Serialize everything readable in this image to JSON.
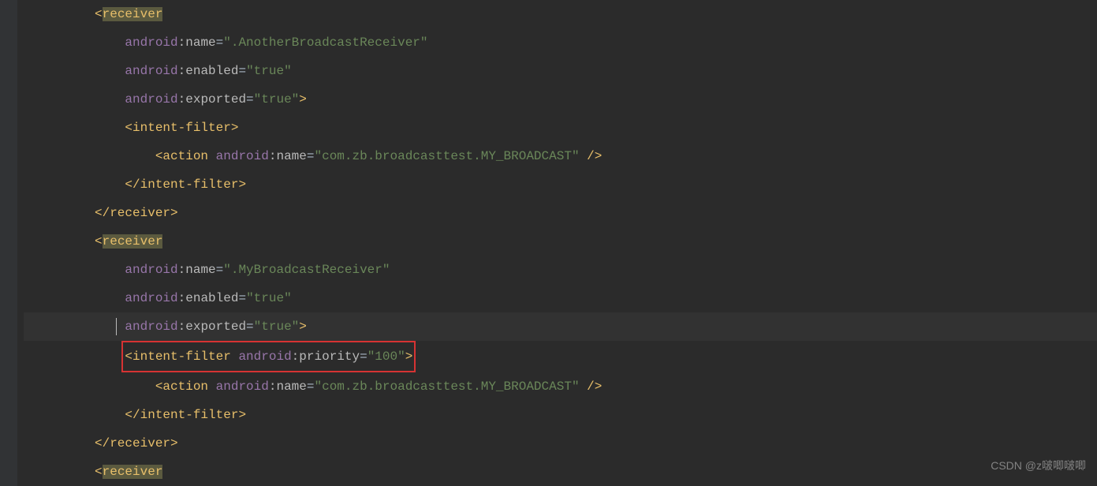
{
  "code": {
    "line1": {
      "tag": "receiver"
    },
    "line2": {
      "ns": "android",
      "attr": "name",
      "val": "\".AnotherBroadcastReceiver\""
    },
    "line3": {
      "ns": "android",
      "attr": "enabled",
      "val": "\"true\""
    },
    "line4": {
      "ns": "android",
      "attr": "exported",
      "val": "\"true\""
    },
    "line5": {
      "tag": "intent-filter"
    },
    "line6": {
      "tag": "action",
      "ns": "android",
      "attr": "name",
      "val": "\"com.zb.broadcasttest.MY_BROADCAST\""
    },
    "line7": {
      "tag": "intent-filter"
    },
    "line8": {
      "tag": "receiver"
    },
    "line9": {
      "tag": "receiver"
    },
    "line10": {
      "ns": "android",
      "attr": "name",
      "val": "\".MyBroadcastReceiver\""
    },
    "line11": {
      "ns": "android",
      "attr": "enabled",
      "val": "\"true\""
    },
    "line12": {
      "ns": "android",
      "attr": "exported",
      "val": "\"true\""
    },
    "line13": {
      "tag": "intent-filter",
      "ns": "android",
      "attr": "priority",
      "val": "\"100\""
    },
    "line14": {
      "tag": "action",
      "ns": "android",
      "attr": "name",
      "val": "\"com.zb.broadcasttest.MY_BROADCAST\""
    },
    "line15": {
      "tag": "intent-filter"
    },
    "line16": {
      "tag": "receiver"
    },
    "line17": {
      "tag": "receiver"
    }
  },
  "watermark": "CSDN @z啵唧啵唧"
}
